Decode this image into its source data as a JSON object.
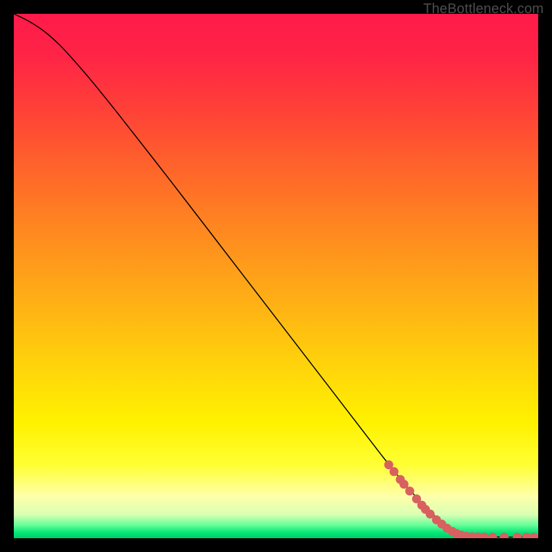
{
  "watermark": "TheBottleneck.com",
  "colors": {
    "gradient_stops": [
      {
        "offset": 0.0,
        "color": "#ff1a4a"
      },
      {
        "offset": 0.08,
        "color": "#ff2446"
      },
      {
        "offset": 0.18,
        "color": "#ff4038"
      },
      {
        "offset": 0.3,
        "color": "#ff662a"
      },
      {
        "offset": 0.42,
        "color": "#ff8a1f"
      },
      {
        "offset": 0.55,
        "color": "#ffb015"
      },
      {
        "offset": 0.68,
        "color": "#ffd60a"
      },
      {
        "offset": 0.78,
        "color": "#fff200"
      },
      {
        "offset": 0.86,
        "color": "#ffff33"
      },
      {
        "offset": 0.92,
        "color": "#ffffaa"
      },
      {
        "offset": 0.955,
        "color": "#d9ffb3"
      },
      {
        "offset": 0.975,
        "color": "#66ff99"
      },
      {
        "offset": 0.99,
        "color": "#00e676"
      },
      {
        "offset": 1.0,
        "color": "#00cc66"
      }
    ],
    "curve": "#000000",
    "markers": "#d86060",
    "background": "#000000"
  },
  "chart_data": {
    "type": "line",
    "title": "",
    "xlabel": "",
    "ylabel": "",
    "xlim": [
      0,
      100
    ],
    "ylim": [
      0,
      100
    ],
    "series": [
      {
        "name": "curve",
        "x": [
          0.0,
          3.0,
          6.0,
          9.0,
          12.0,
          15.0,
          20.0,
          30.0,
          40.0,
          50.0,
          60.0,
          70.0,
          75.0,
          80.0,
          83.0,
          85.0,
          87.0,
          90.0,
          95.0,
          100.0
        ],
        "y": [
          100.0,
          98.5,
          96.5,
          93.8,
          90.5,
          87.0,
          80.8,
          68.0,
          55.0,
          42.0,
          29.0,
          16.0,
          9.8,
          4.5,
          2.0,
          1.0,
          0.5,
          0.3,
          0.2,
          0.2
        ]
      }
    ],
    "markers": [
      {
        "x": 71.5,
        "y": 14.0
      },
      {
        "x": 72.5,
        "y": 12.7
      },
      {
        "x": 73.7,
        "y": 11.2
      },
      {
        "x": 74.4,
        "y": 10.3
      },
      {
        "x": 75.5,
        "y": 9.0
      },
      {
        "x": 76.8,
        "y": 7.5
      },
      {
        "x": 77.8,
        "y": 6.3
      },
      {
        "x": 78.5,
        "y": 5.5
      },
      {
        "x": 79.4,
        "y": 4.6
      },
      {
        "x": 80.6,
        "y": 3.5
      },
      {
        "x": 81.6,
        "y": 2.7
      },
      {
        "x": 82.6,
        "y": 1.9
      },
      {
        "x": 83.6,
        "y": 1.3
      },
      {
        "x": 84.4,
        "y": 0.9
      },
      {
        "x": 85.3,
        "y": 0.6
      },
      {
        "x": 86.3,
        "y": 0.35
      },
      {
        "x": 87.4,
        "y": 0.28
      },
      {
        "x": 88.5,
        "y": 0.25
      },
      {
        "x": 89.7,
        "y": 0.22
      },
      {
        "x": 91.3,
        "y": 0.2
      },
      {
        "x": 93.5,
        "y": 0.2
      },
      {
        "x": 96.0,
        "y": 0.2
      },
      {
        "x": 97.8,
        "y": 0.2
      },
      {
        "x": 99.2,
        "y": 0.2
      }
    ]
  }
}
